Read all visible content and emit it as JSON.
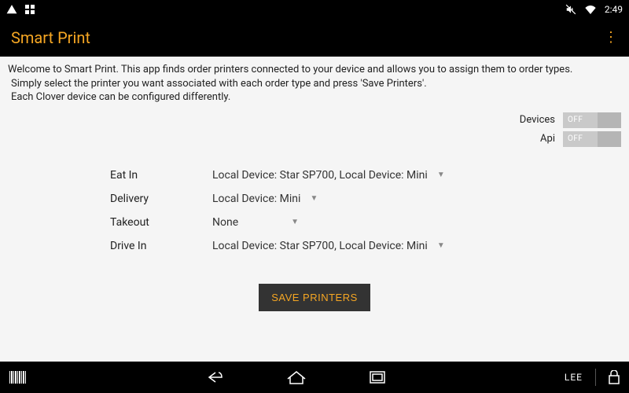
{
  "status": {
    "time": "2:49"
  },
  "app": {
    "title": "Smart Print"
  },
  "intro": {
    "line1": "Welcome to Smart Print. This app finds order printers connected to your device and allows you to assign them to order types.",
    "line2": "Simply select the printer you want associated with each order type and press 'Save Printers'.",
    "line3": "Each Clover device can be configured differently."
  },
  "toggles": {
    "devices": {
      "label": "Devices",
      "state": "OFF"
    },
    "api": {
      "label": "Api",
      "state": "OFF"
    }
  },
  "orderTypes": [
    {
      "name": "Eat In",
      "value": "Local Device: Star SP700, Local Device: Mini"
    },
    {
      "name": "Delivery",
      "value": "Local Device: Mini"
    },
    {
      "name": "Takeout",
      "value": "None"
    },
    {
      "name": "Drive In",
      "value": "Local Device: Star SP700, Local Device: Mini"
    }
  ],
  "buttons": {
    "save": "SAVE PRINTERS"
  },
  "nav": {
    "user": "LEE"
  }
}
